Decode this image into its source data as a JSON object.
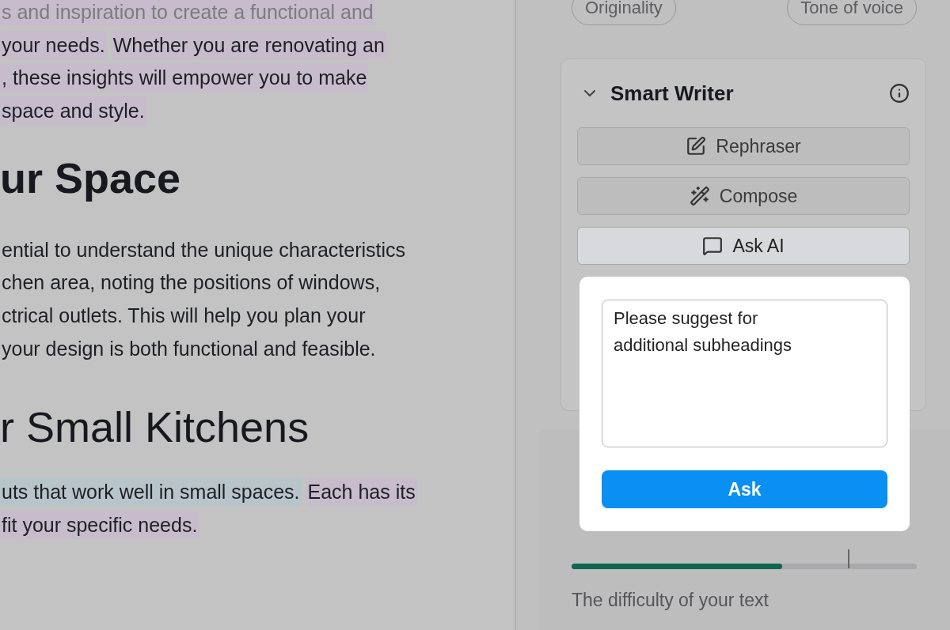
{
  "editor": {
    "blocks": [
      {
        "kind": "paragraph",
        "faded": true,
        "lines": [
          [
            {
              "text": "s and inspiration to create a functional and",
              "color": "#c6bccb"
            }
          ]
        ]
      },
      {
        "kind": "paragraph",
        "faded": false,
        "lines": [
          [
            {
              "text": "your needs.",
              "color": "#c6bccb"
            },
            {
              "text": "Whether you are renovating an",
              "color": "#c6bccb"
            }
          ],
          [
            {
              "text": ", these insights will empower you to make",
              "color": "#c6bccb"
            }
          ],
          [
            {
              "text": "space and style.",
              "color": "#c6bccb"
            }
          ]
        ]
      },
      {
        "kind": "heading",
        "bold": true,
        "text": "ur Space"
      },
      {
        "kind": "paragraph",
        "faded": false,
        "lines": [
          [
            {
              "text": "ential to understand the unique characteristics"
            }
          ],
          [
            {
              "text": "chen area, noting the positions of windows,"
            }
          ],
          [
            {
              "text": "ctrical outlets. This will help you plan your"
            }
          ],
          [
            {
              "text": "your design is both functional and feasible."
            }
          ]
        ]
      },
      {
        "kind": "heading",
        "bold": false,
        "text": "r Small Kitchens"
      },
      {
        "kind": "paragraph",
        "faded": false,
        "lines": [
          [
            {
              "text": "uts that work well in small spaces.",
              "color": "#b7c5ca"
            },
            {
              "text": "Each has its",
              "color": "#c6bccb"
            }
          ],
          [
            {
              "text": "fit your specific needs.",
              "color": "#c6bccb"
            }
          ]
        ]
      }
    ]
  },
  "filters": [
    "Originality",
    "Tone of voice"
  ],
  "smart_writer": {
    "title": "Smart Writer",
    "expanded": true,
    "tools": [
      {
        "kind": "rephraser",
        "label": "Rephraser",
        "selected": false
      },
      {
        "kind": "compose",
        "label": "Compose",
        "selected": false
      },
      {
        "kind": "ask",
        "label": "Ask AI",
        "selected": true
      }
    ]
  },
  "ask_popup": {
    "value": "Please suggest for additional subheadings",
    "button": "Ask"
  },
  "readability": {
    "level": 0.61,
    "description": "The difficulty of your text"
  }
}
